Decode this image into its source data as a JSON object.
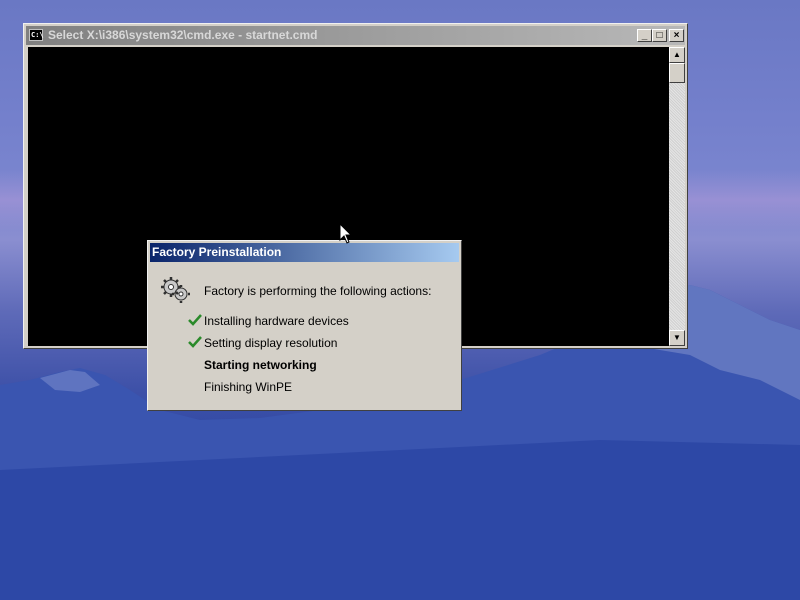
{
  "console": {
    "title": "Select X:\\i386\\system32\\cmd.exe - startnet.cmd",
    "icon_text": "C:\\",
    "buttons": {
      "minimize": "_",
      "maximize": "□",
      "close": "×"
    },
    "scroll_up": "▲",
    "scroll_down": "▼"
  },
  "dialog": {
    "title": "Factory Preinstallation",
    "intro": "Factory is performing the following actions:",
    "actions": [
      {
        "label": "Installing hardware devices",
        "status": "done"
      },
      {
        "label": "Setting display resolution",
        "status": "done"
      },
      {
        "label": "Starting networking",
        "status": "current"
      },
      {
        "label": "Finishing WinPE",
        "status": "pending"
      }
    ]
  },
  "colors": {
    "check": "#2a8a2a",
    "dialog_title_start": "#0a246a",
    "dialog_title_end": "#a6caf0",
    "inactive_title": "#808080"
  }
}
